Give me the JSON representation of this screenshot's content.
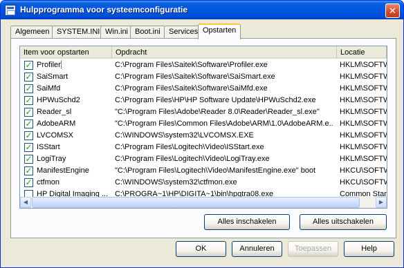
{
  "window": {
    "title": "Hulpprogramma voor systeemconfiguratie",
    "close_label": "✕"
  },
  "tabs": [
    {
      "label": "Algemeen"
    },
    {
      "label": "SYSTEM.INI"
    },
    {
      "label": "Win.ini"
    },
    {
      "label": "Boot.ini"
    },
    {
      "label": "Services"
    },
    {
      "label": "Opstarten",
      "active": true
    }
  ],
  "list": {
    "columns": [
      "Item voor opstarten",
      "Opdracht",
      "Locatie"
    ],
    "rows": [
      {
        "checked": true,
        "item": "Profiler",
        "command": "C:\\Program Files\\Saitek\\Software\\Profiler.exe",
        "location": "HKLM\\SOFTWARE"
      },
      {
        "checked": true,
        "item": "SaiSmart",
        "command": "C:\\Program Files\\Saitek\\Software\\SaiSmart.exe",
        "location": "HKLM\\SOFTWARE"
      },
      {
        "checked": true,
        "item": "SaiMfd",
        "command": "C:\\Program Files\\Saitek\\Software\\SaiMfd.exe",
        "location": "HKLM\\SOFTWARE"
      },
      {
        "checked": true,
        "item": "HPWuSchd2",
        "command": "C:\\Program Files\\HP\\HP Software Update\\HPWuSchd2.exe",
        "location": "HKLM\\SOFTWARE"
      },
      {
        "checked": true,
        "item": "Reader_sl",
        "command": "\"C:\\Program Files\\Adobe\\Reader 8.0\\Reader\\Reader_sl.exe\"",
        "location": "HKLM\\SOFTWARE"
      },
      {
        "checked": true,
        "item": "AdobeARM",
        "command": "\"C:\\Program Files\\Common Files\\Adobe\\ARM\\1.0\\AdobeARM.e...",
        "location": "HKLM\\SOFTWARE"
      },
      {
        "checked": true,
        "item": "LVCOMSX",
        "command": "C:\\WINDOWS\\system32\\LVCOMSX.EXE",
        "location": "HKLM\\SOFTWARE"
      },
      {
        "checked": true,
        "item": "ISStart",
        "command": "C:\\Program Files\\Logitech\\Video\\ISStart.exe",
        "location": "HKLM\\SOFTWARE"
      },
      {
        "checked": true,
        "item": "LogiTray",
        "command": "C:\\Program Files\\Logitech\\Video\\LogiTray.exe",
        "location": "HKLM\\SOFTWARE"
      },
      {
        "checked": true,
        "item": "ManifestEngine",
        "command": "\"C:\\Program Files\\Logitech\\Video\\ManifestEngine.exe\" boot",
        "location": "HKCU\\SOFTWARE"
      },
      {
        "checked": true,
        "item": "ctfmon",
        "command": "C:\\WINDOWS\\system32\\ctfmon.exe",
        "location": "HKCU\\SOFTWARE"
      },
      {
        "checked": false,
        "item": "HP Digital Imaging ...",
        "command": "C:\\PROGRA~1\\HP\\DIGITA~1\\bin\\hpqtra08.exe",
        "location": "Common Startup"
      }
    ]
  },
  "buttons": {
    "enable_all": "Alles inschakelen",
    "disable_all": "Alles uitschakelen",
    "ok": "OK",
    "cancel": "Annuleren",
    "apply": "Toepassen",
    "help": "Help"
  },
  "icons": {
    "app": "system-config-icon",
    "scroll_left": "arrow-left-icon",
    "scroll_right": "arrow-right-icon"
  }
}
